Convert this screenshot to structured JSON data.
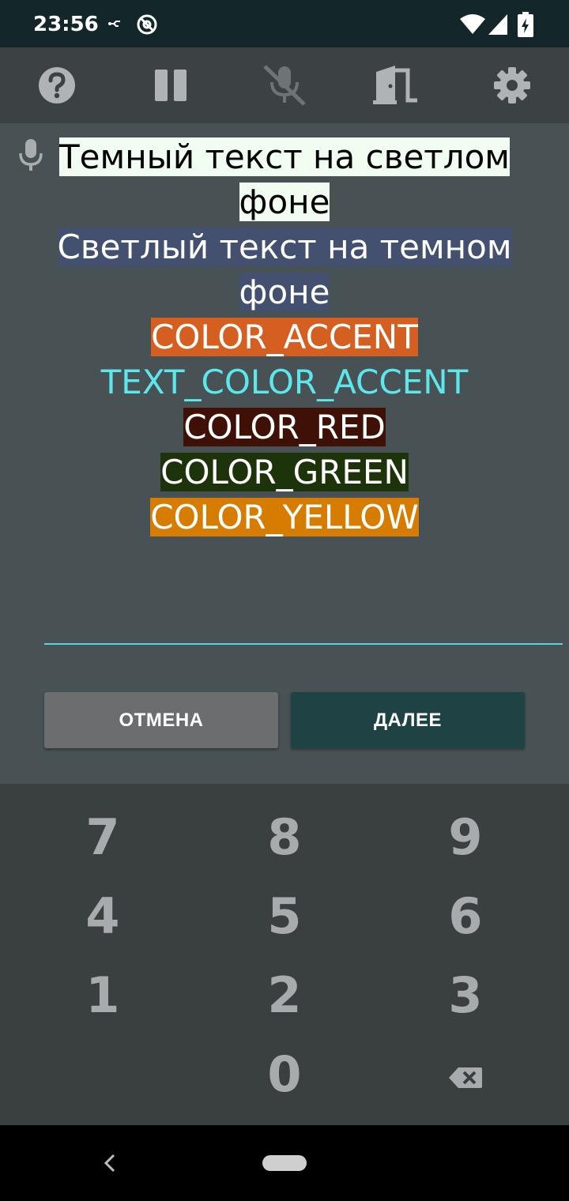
{
  "status_bar": {
    "time": "23:56",
    "icons": [
      "usb-debug-icon",
      "no-disturb-icon",
      "wifi-icon",
      "signal-icon",
      "battery-charging-icon"
    ]
  },
  "toolbar": {
    "icons": [
      "help-icon",
      "pause-icon",
      "mic-off-icon",
      "exit-door-icon",
      "settings-icon"
    ]
  },
  "messages": [
    {
      "text": "Темный текст на светлом фоне",
      "fg": "#000000",
      "bg": "#f0fdf0"
    },
    {
      "text": "Светлый текст на темном фоне",
      "fg": "#ffffff",
      "bg": "#43506f"
    },
    {
      "text": "COLOR_ACCENT",
      "fg": "#ffffff",
      "bg": "#d45f20"
    },
    {
      "text": "TEXT_COLOR_ACCENT",
      "fg": "#5be7ec",
      "bg": "transparent"
    },
    {
      "text": "COLOR_RED",
      "fg": "#ffffff",
      "bg": "#3f1106"
    },
    {
      "text": "COLOR_GREEN",
      "fg": "#ffffff",
      "bg": "#1d330a"
    },
    {
      "text": "COLOR_YELLOW",
      "fg": "#ffffff",
      "bg": "#d67c00"
    }
  ],
  "buttons": {
    "cancel": "ОТМЕНА",
    "next": "ДАЛЕЕ"
  },
  "keypad": {
    "rows": [
      [
        "7",
        "8",
        "9"
      ],
      [
        "4",
        "5",
        "6"
      ],
      [
        "1",
        "2",
        "3"
      ],
      [
        "",
        "0",
        "backspace"
      ]
    ]
  },
  "colors": {
    "accent_line": "#5fd3d8",
    "keypad_bg": "#3a3f40",
    "toolbar_bg": "#3c4244"
  }
}
